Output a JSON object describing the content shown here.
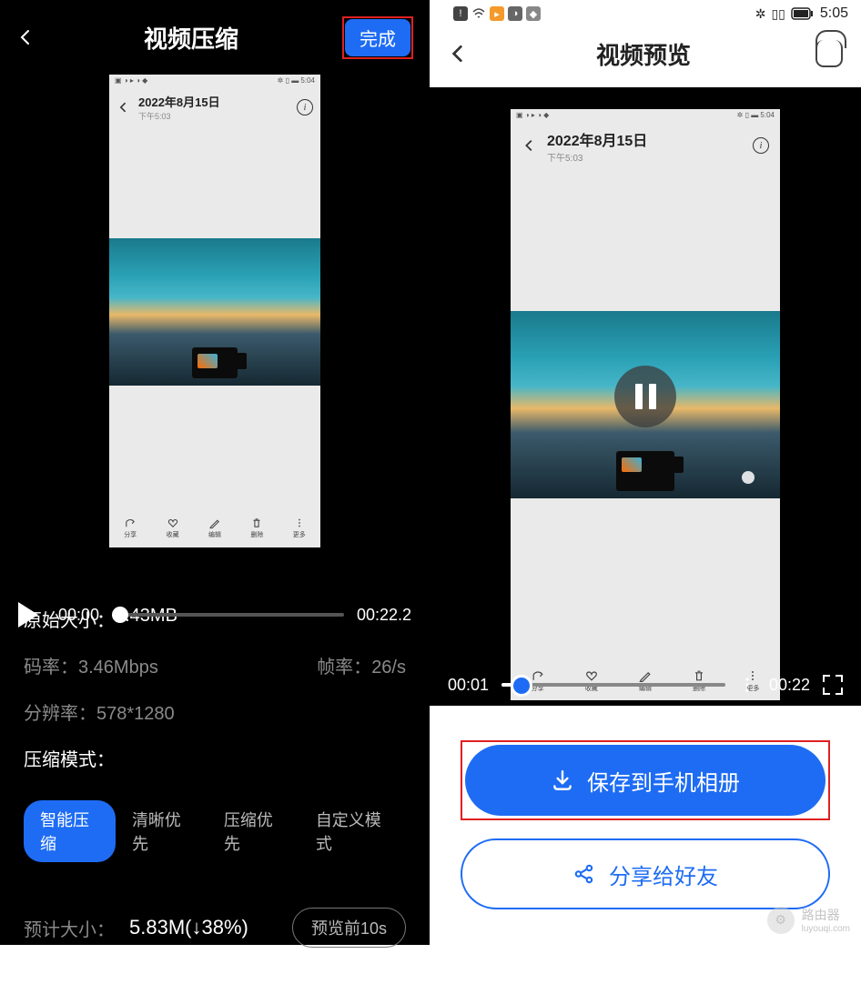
{
  "left": {
    "title": "视频压缩",
    "done": "完成",
    "video_header": {
      "date": "2022年8月15日",
      "time": "下午5:03",
      "status_time": "5:04"
    },
    "toolbar": [
      "分享",
      "收藏",
      "编辑",
      "删除",
      "更多"
    ],
    "time_start": "00:00",
    "time_end": "00:22.2",
    "orig_label": "原始大小：",
    "orig_value": "9.43MB",
    "bitrate_label": "码率：",
    "bitrate_value": "3.46Mbps",
    "fps_label": "帧率：",
    "fps_value": "26/s",
    "res_label": "分辨率：",
    "res_value": "578*1280",
    "mode_label": "压缩模式：",
    "modes": [
      "智能压缩",
      "清晰优先",
      "压缩优先",
      "自定义模式"
    ],
    "est_label": "预计大小：",
    "est_value": "5.83M(↓38%)",
    "preview_btn": "预览前10s"
  },
  "right": {
    "status_time": "5:05",
    "title": "视频预览",
    "video_header": {
      "date": "2022年8月15日",
      "time": "下午5:03",
      "status_time": "5:04"
    },
    "toolbar": [
      "分享",
      "收藏",
      "编辑",
      "删除",
      "更多"
    ],
    "time_start": "00:01",
    "time_end": "00:22",
    "save_btn": "保存到手机相册",
    "share_btn": "分享给好友",
    "watermark": {
      "name": "路由器",
      "url": "luyouqi.com"
    }
  },
  "colors": {
    "accent": "#1e6cf4",
    "highlight": "#e02020"
  }
}
